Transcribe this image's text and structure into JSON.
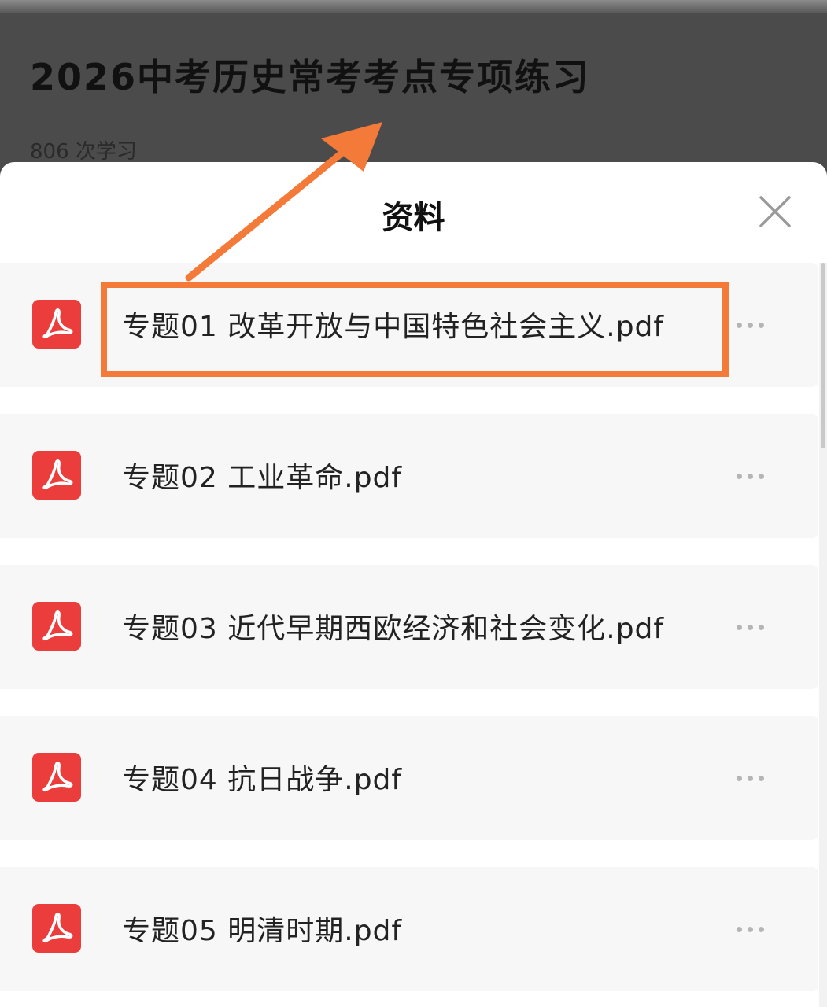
{
  "background_page": {
    "course_title": "2026中考历史常考考点专项练习",
    "study_count": "806 次学习"
  },
  "sheet": {
    "title": "资料",
    "close_icon": "close-icon"
  },
  "files": [
    {
      "name": "专题01 改革开放与中国特色社会主义.pdf",
      "icon": "pdf-icon",
      "highlighted": true
    },
    {
      "name": "专题02 工业革命.pdf",
      "icon": "pdf-icon",
      "highlighted": false
    },
    {
      "name": "专题03 近代早期西欧经济和社会变化.pdf",
      "icon": "pdf-icon",
      "highlighted": false
    },
    {
      "name": "专题04 抗日战争.pdf",
      "icon": "pdf-icon",
      "highlighted": false
    },
    {
      "name": "专题05 明清时期.pdf",
      "icon": "pdf-icon",
      "highlighted": false
    }
  ],
  "colors": {
    "pdf_red": "#ec3d3d",
    "annotation_orange": "#f47a3a",
    "overlay_gray": "#4b4b4b"
  }
}
